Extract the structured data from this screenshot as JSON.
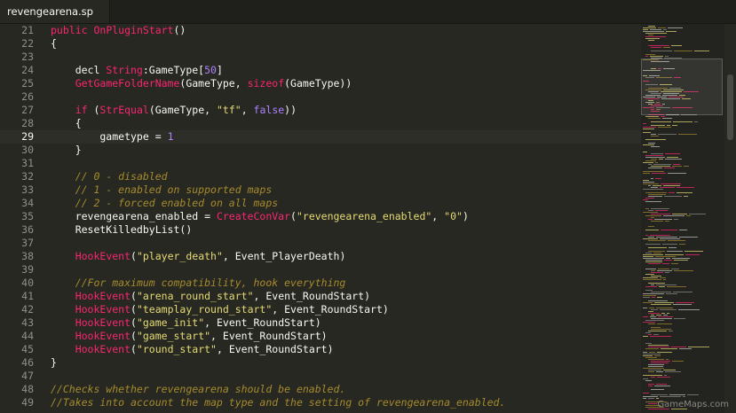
{
  "tab": {
    "title": "revengearena.sp"
  },
  "editor": {
    "current_line": 29,
    "lines": [
      {
        "n": "21",
        "html": "<span class=\"kw\">public</span> <span class=\"fn\">OnPluginStart</span>()"
      },
      {
        "n": "22",
        "html": "{"
      },
      {
        "n": "23",
        "html": ""
      },
      {
        "n": "24",
        "html": "    decl <span class=\"kw\">String</span>:GameType[<span class=\"nm\">50</span>]"
      },
      {
        "n": "25",
        "html": "    <span class=\"fn\">GetGameFolderName</span>(GameType, <span class=\"fn\">sizeof</span>(GameType))"
      },
      {
        "n": "26",
        "html": ""
      },
      {
        "n": "27",
        "html": "    <span class=\"kw\">if</span> (<span class=\"fn\">StrEqual</span>(GameType, <span class=\"st\">\"tf\"</span>, <span class=\"bool\">false</span>))"
      },
      {
        "n": "28",
        "html": "    {"
      },
      {
        "n": "29",
        "html": "        gametype = <span class=\"nm\">1</span>"
      },
      {
        "n": "30",
        "html": "    }"
      },
      {
        "n": "31",
        "html": ""
      },
      {
        "n": "32",
        "html": "    <span class=\"cm\">// 0 - disabled</span>"
      },
      {
        "n": "33",
        "html": "    <span class=\"cm\">// 1 - enabled on supported maps</span>"
      },
      {
        "n": "34",
        "html": "    <span class=\"cm\">// 2 - forced enabled on all maps</span>"
      },
      {
        "n": "35",
        "html": "    revengearena_enabled = <span class=\"fn\">CreateConVar</span>(<span class=\"st\">\"revengearena_enabled\"</span>, <span class=\"st\">\"0\"</span>)"
      },
      {
        "n": "36",
        "html": "    ResetKilledbyList()"
      },
      {
        "n": "37",
        "html": ""
      },
      {
        "n": "38",
        "html": "    <span class=\"fn\">HookEvent</span>(<span class=\"st\">\"player_death\"</span>, Event_PlayerDeath)"
      },
      {
        "n": "39",
        "html": ""
      },
      {
        "n": "40",
        "html": "    <span class=\"cm\">//For maximum compatibility, hook everything</span>"
      },
      {
        "n": "41",
        "html": "    <span class=\"fn\">HookEvent</span>(<span class=\"st\">\"arena_round_start\"</span>, Event_RoundStart)"
      },
      {
        "n": "42",
        "html": "    <span class=\"fn\">HookEvent</span>(<span class=\"st\">\"teamplay_round_start\"</span>, Event_RoundStart)"
      },
      {
        "n": "43",
        "html": "    <span class=\"fn\">HookEvent</span>(<span class=\"st\">\"game_init\"</span>, Event_RoundStart)"
      },
      {
        "n": "44",
        "html": "    <span class=\"fn\">HookEvent</span>(<span class=\"st\">\"game_start\"</span>, Event_RoundStart)"
      },
      {
        "n": "45",
        "html": "    <span class=\"fn\">HookEvent</span>(<span class=\"st\">\"round_start\"</span>, Event_RoundStart)"
      },
      {
        "n": "46",
        "html": "}"
      },
      {
        "n": "47",
        "html": ""
      },
      {
        "n": "48",
        "html": "<span class=\"cm\">//Checks whether revengearena should be enabled.</span>"
      },
      {
        "n": "49",
        "html": "<span class=\"cm\">//Takes into account the map type and the setting of revengearena_enabled.</span>"
      }
    ]
  },
  "watermark": {
    "text": "GameMaps.com"
  },
  "colors": {
    "background": "#272822",
    "keyword": "#f92672",
    "string": "#e6db74",
    "number": "#ae81ff",
    "comment": "#a68a2d"
  }
}
